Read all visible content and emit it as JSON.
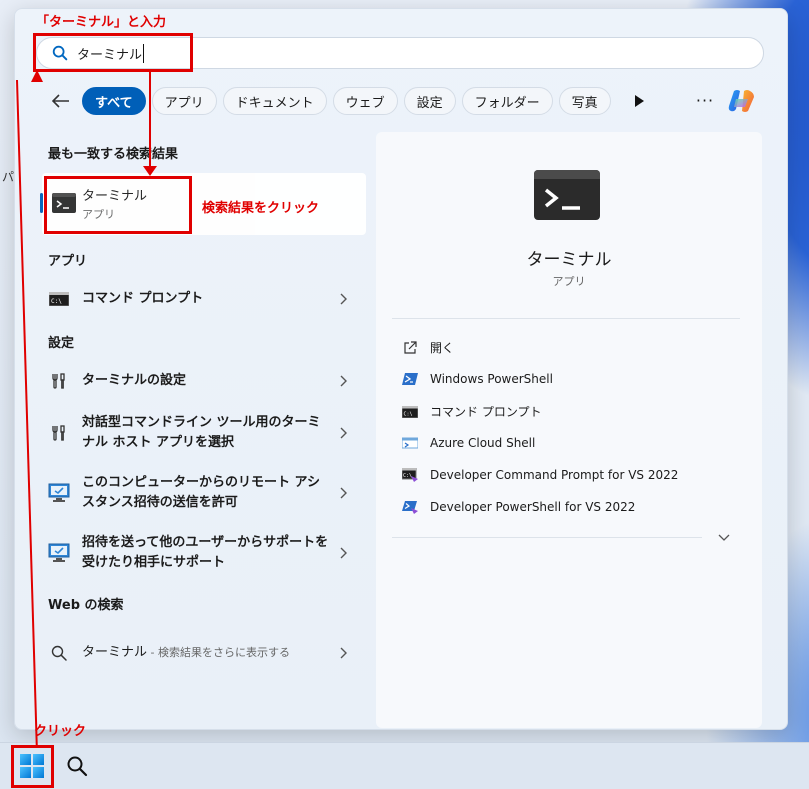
{
  "search": {
    "value": "ターミナル"
  },
  "filters": {
    "items": [
      "すべて",
      "アプリ",
      "ドキュメント",
      "ウェブ",
      "設定",
      "フォルダー",
      "写真"
    ],
    "more": "···"
  },
  "sections": {
    "best_match": "最も一致する検索結果",
    "apps": "アプリ",
    "settings": "設定",
    "web": "Web の検索"
  },
  "best_match": {
    "title": "ターミナル",
    "subtitle": "アプリ"
  },
  "apps": [
    {
      "label": "コマンド プロンプト",
      "icon": "cmd-icon"
    }
  ],
  "settings": [
    {
      "label": "ターミナルの設定",
      "icon": "wrench-screwdriver-icon"
    },
    {
      "label": "対話型コマンドライン ツール用のターミナル ホスト アプリを選択",
      "icon": "wrench-screwdriver-icon"
    },
    {
      "label": "このコンピューターからのリモート アシスタンス招待の送信を許可",
      "icon": "remote-assistance-icon"
    },
    {
      "label": "招待を送って他のユーザーからサポートを受けたり相手にサポート",
      "icon": "remote-assistance-icon"
    }
  ],
  "web": {
    "query": "ターミナル",
    "suffix": " - 検索結果をさらに表示する"
  },
  "detail": {
    "title": "ターミナル",
    "subtitle": "アプリ",
    "actions": [
      {
        "label": "開く",
        "icon": "open-external-icon"
      },
      {
        "label": "Windows PowerShell",
        "icon": "powershell-icon"
      },
      {
        "label": "コマンド プロンプト",
        "icon": "cmd-icon"
      },
      {
        "label": "Azure Cloud Shell",
        "icon": "azure-cloud-shell-icon"
      },
      {
        "label": "Developer Command Prompt for VS 2022",
        "icon": "dev-cmd-icon"
      },
      {
        "label": "Developer PowerShell for VS 2022",
        "icon": "dev-powershell-icon"
      }
    ]
  },
  "annotations": {
    "type_label": "「ターミナル」と入力",
    "click_result": "検索結果をクリック",
    "click_start": "クリック",
    "color": "#e00000"
  },
  "colors": {
    "accent": "#005fb8",
    "annotation": "#e00000"
  }
}
